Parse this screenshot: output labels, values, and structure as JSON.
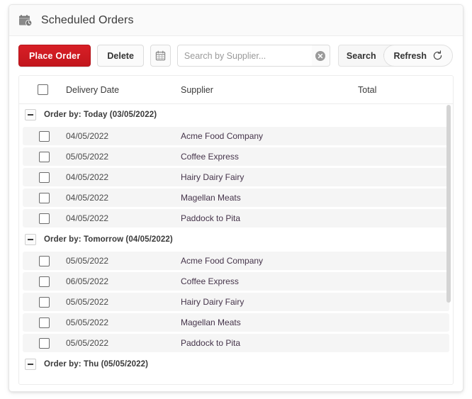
{
  "header": {
    "title": "Scheduled Orders",
    "icon": "calendar-clock-icon"
  },
  "toolbar": {
    "place_order_label": "Place Order",
    "delete_label": "Delete",
    "calendar_icon": "calendar-icon",
    "search_placeholder": "Search by Supplier...",
    "search_value": "",
    "clear_icon": "clear-circle-x-icon",
    "search_label": "Search",
    "search_icon": "search-icon",
    "refresh_label": "Refresh",
    "refresh_icon": "refresh-icon"
  },
  "table": {
    "columns": {
      "delivery_date": "Delivery Date",
      "supplier": "Supplier",
      "total": "Total"
    },
    "groups": [
      {
        "label": "Order by: Today (03/05/2022)",
        "collapsed": false,
        "rows": [
          {
            "date": "04/05/2022",
            "supplier": "Acme Food Company",
            "total": ""
          },
          {
            "date": "05/05/2022",
            "supplier": "Coffee Express",
            "total": ""
          },
          {
            "date": "04/05/2022",
            "supplier": "Hairy Dairy Fairy",
            "total": ""
          },
          {
            "date": "04/05/2022",
            "supplier": "Magellan Meats",
            "total": ""
          },
          {
            "date": "04/05/2022",
            "supplier": "Paddock to Pita",
            "total": ""
          }
        ]
      },
      {
        "label": "Order by: Tomorrow (04/05/2022)",
        "collapsed": false,
        "rows": [
          {
            "date": "05/05/2022",
            "supplier": "Acme Food Company",
            "total": ""
          },
          {
            "date": "06/05/2022",
            "supplier": "Coffee Express",
            "total": ""
          },
          {
            "date": "05/05/2022",
            "supplier": "Hairy Dairy Fairy",
            "total": ""
          },
          {
            "date": "05/05/2022",
            "supplier": "Magellan Meats",
            "total": ""
          },
          {
            "date": "05/05/2022",
            "supplier": "Paddock to Pita",
            "total": ""
          }
        ]
      },
      {
        "label": "Order by: Thu (05/05/2022)",
        "collapsed": false,
        "rows": []
      }
    ]
  },
  "colors": {
    "primary_red": "#c2161d",
    "row_bg": "#f5f5f5",
    "header_bg": "#fafafa",
    "border": "#e6e6e6"
  }
}
